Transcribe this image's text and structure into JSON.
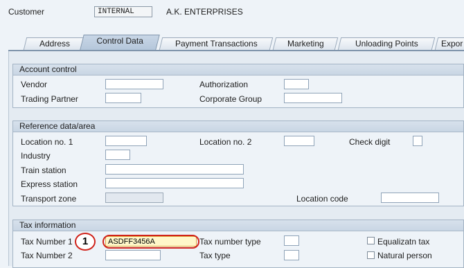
{
  "header": {
    "customer_label": "Customer",
    "customer_code": "INTERNAL",
    "customer_name": "A.K. ENTERPRISES"
  },
  "tabs": [
    {
      "label": "Address"
    },
    {
      "label": "Control Data"
    },
    {
      "label": "Payment Transactions"
    },
    {
      "label": "Marketing"
    },
    {
      "label": "Unloading Points"
    },
    {
      "label": "Expor"
    }
  ],
  "active_tab": "Control Data",
  "account_control": {
    "title": "Account control",
    "vendor_label": "Vendor",
    "vendor_value": "",
    "authorization_label": "Authorization",
    "authorization_value": "",
    "trading_partner_label": "Trading Partner",
    "trading_partner_value": "",
    "corporate_group_label": "Corporate Group",
    "corporate_group_value": ""
  },
  "reference": {
    "title": "Reference data/area",
    "location1_label": "Location no. 1",
    "location2_label": "Location no. 2",
    "check_digit_label": "Check digit",
    "industry_label": "Industry",
    "train_station_label": "Train station",
    "express_station_label": "Express station",
    "transport_zone_label": "Transport zone",
    "location_code_label": "Location code"
  },
  "tax": {
    "title": "Tax information",
    "tax_number_label": "Tax Number 1",
    "tax_number_value": "ASDFF3456A",
    "tax_number_type_label": "Tax number type",
    "equalization_label": "Equalizatn tax",
    "tax_number2_label": "Tax Number 2",
    "tax_type_label": "Tax type",
    "natural_person_label": "Natural person"
  },
  "annotation": {
    "step_number": "1"
  },
  "colors": {
    "background": "#eef3f8",
    "group_header": "#d7e1ec",
    "active_tab": "#b5c7db",
    "highlight": "#d0231b",
    "input_highlight": "#fff7c9"
  }
}
